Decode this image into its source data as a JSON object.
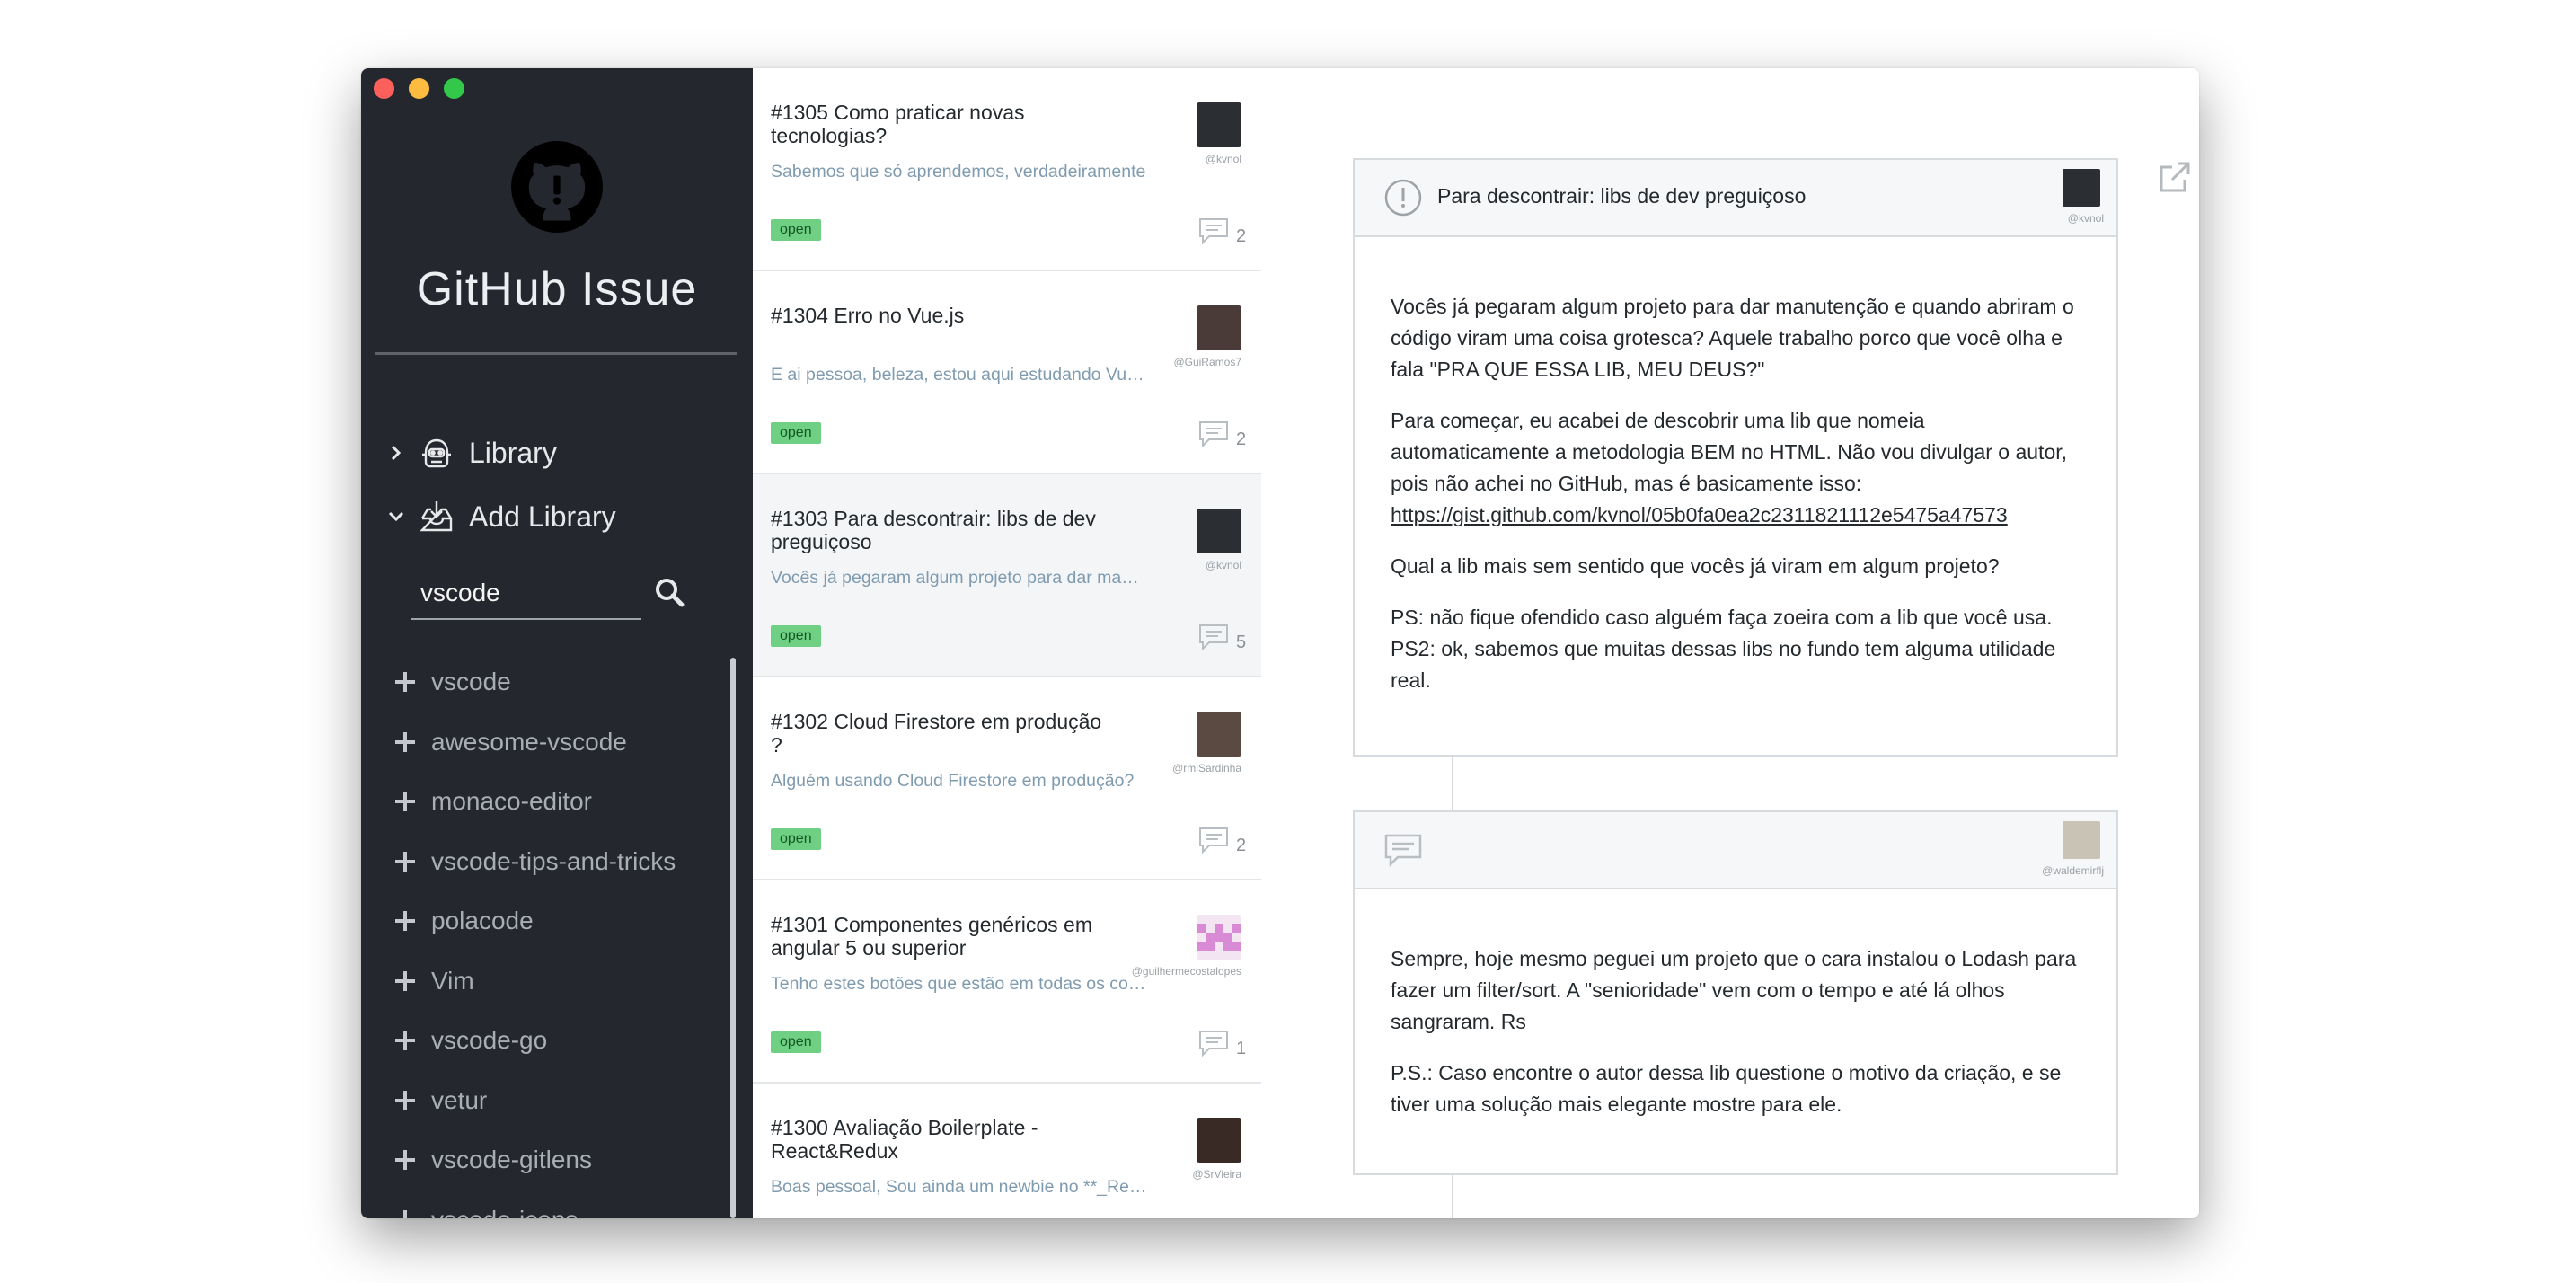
{
  "sidebar": {
    "app_title": "GitHub Issue",
    "nav": [
      {
        "label": "Library",
        "icon": "robot-icon"
      },
      {
        "label": "Add Library",
        "icon": "inbox-download-icon"
      }
    ],
    "search": {
      "value": "vscode",
      "placeholder": ""
    },
    "libraries": [
      "vscode",
      "awesome-vscode",
      "monaco-editor",
      "vscode-tips-and-tricks",
      "polacode",
      "Vim",
      "vscode-go",
      "vetur",
      "vscode-gitlens",
      "vscode-icons"
    ]
  },
  "issues": [
    {
      "title": "#1305 Como praticar novas tecnologias?",
      "snippet": "Sabemos que só aprendemos, verdadeiramente",
      "user": "@kvnol",
      "state": "open",
      "comments": "2",
      "avatar_color": "#2b2f33"
    },
    {
      "title": "#1304 Erro no Vue.js",
      "snippet": "E ai pessoa, beleza, estou aqui estudando Vue.js",
      "user": "@GuiRamos7",
      "state": "open",
      "comments": "2",
      "avatar_color": "#4a3b38"
    },
    {
      "title": "#1303 Para descontrair: libs de dev preguiçoso",
      "snippet": "Vocês já pegaram algum projeto para dar manutenção",
      "user": "@kvnol",
      "state": "open",
      "comments": "5",
      "avatar_color": "#2b2f33"
    },
    {
      "title": "#1302 Cloud Firestore em produção ?",
      "snippet": "Alguém usando Cloud Firestore em produção?",
      "user": "@rmlSardinha",
      "state": "open",
      "comments": "2",
      "avatar_color": "#5a4a42"
    },
    {
      "title": "#1301 Componentes genéricos em angular 5 ou superior",
      "snippet": "Tenho estes botões que estão em todas os componentes",
      "user": "@guilhermecostalopes",
      "state": "open",
      "comments": "1",
      "avatar_color": "#e7c6e6"
    },
    {
      "title": "#1300 Avaliação Boilerplate - React&Redux",
      "snippet": "Boas pessoal,  Sou ainda um newbie no **_React",
      "user": "@SrVieira",
      "state": "open",
      "comments": "",
      "avatar_color": "#3a2a26"
    }
  ],
  "detail": {
    "title": "Para descontrair: libs de dev preguiçoso",
    "author": "@kvnol",
    "body": [
      "Vocês já pegaram algum projeto para dar manutenção e quando abriram o código viram uma coisa grotesca? Aquele trabalho porco que você olha e fala \"PRA QUE ESSA LIB, MEU DEUS?\"",
      "Para começar, eu acabei de descobrir uma lib que nomeia automaticamente a metodologia BEM no HTML. Não vou divulgar o autor, pois não achei no GitHub, mas é basicamente isso:",
      "Qual a lib mais sem sentido que vocês já viram em algum projeto?",
      "PS: não fique ofendido caso alguém faça zoeira com a lib que você usa.",
      "PS2: ok, sabemos que muitas dessas libs no fundo tem alguma utilidade real."
    ],
    "link": "https://gist.github.com/kvnol/05b0fa0ea2c2311821112e5475a47573",
    "comments": [
      {
        "author": "@waldemirflj",
        "body": [
          "Sempre, hoje mesmo peguei um projeto que o cara instalou o Lodash para fazer um filter/sort. A \"senioridade\" vem com o tempo e até lá olhos sangraram. Rs",
          "P.S.: Caso encontre o autor dessa lib questione o motivo da criação, e se tiver uma solução mais elegante mostre para ele."
        ]
      }
    ]
  },
  "colors": {
    "sidebar_bg": "#24272d",
    "badge_open": "#6fd084",
    "snippet_text": "#7f9bb0"
  }
}
